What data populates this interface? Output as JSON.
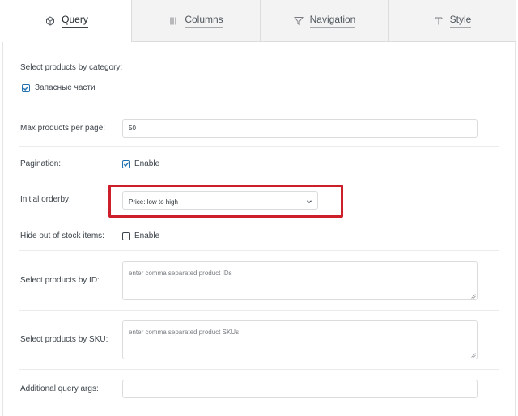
{
  "tabs": [
    {
      "label": "Query",
      "icon": "cube-icon",
      "active": true
    },
    {
      "label": "Columns",
      "icon": "columns-icon",
      "active": false
    },
    {
      "label": "Navigation",
      "icon": "filter-icon",
      "active": false
    },
    {
      "label": "Style",
      "icon": "text-t-icon",
      "active": false
    }
  ],
  "category": {
    "label": "Select products by category:",
    "option_label": "Запасные части",
    "option_checked": true
  },
  "max_products": {
    "label": "Max products per page:",
    "value": "50"
  },
  "pagination": {
    "label": "Pagination:",
    "option_label": "Enable",
    "checked": true
  },
  "orderby": {
    "label": "Initial orderby:",
    "selected": "Price: low to high"
  },
  "hide_out_of_stock": {
    "label": "Hide out of stock items:",
    "option_label": "Enable",
    "checked": false
  },
  "products_by_id": {
    "label": "Select products by ID:",
    "placeholder": "enter comma separated product IDs"
  },
  "products_by_sku": {
    "label": "Select products by SKU:",
    "placeholder": "enter comma separated product SKUs"
  },
  "query_args": {
    "label": "Additional query args:",
    "value": ""
  },
  "colors": {
    "highlight": "#cc1f2a",
    "checkbox_checked": "#2271b1"
  }
}
